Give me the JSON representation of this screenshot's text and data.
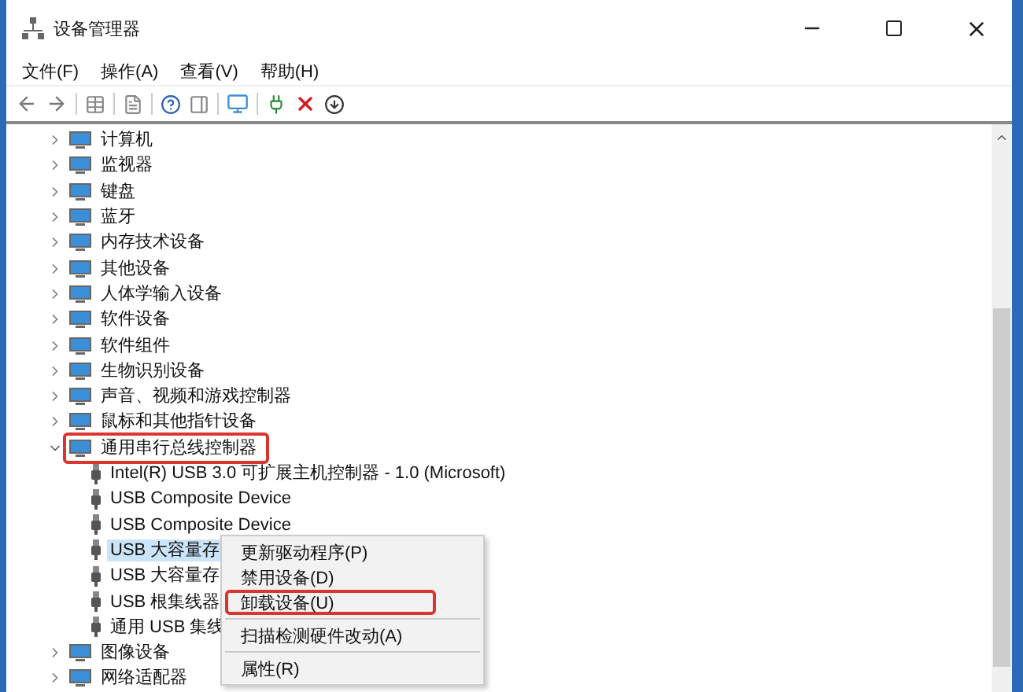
{
  "window": {
    "title": "设备管理器"
  },
  "menu_bar": [
    "文件(F)",
    "操作(A)",
    "查看(V)",
    "帮助(H)"
  ],
  "tree": [
    {
      "label": "计算机",
      "expanded": false,
      "selected": false,
      "highlighted": false
    },
    {
      "label": "监视器",
      "expanded": false,
      "selected": false,
      "highlighted": false
    },
    {
      "label": "键盘",
      "expanded": false,
      "selected": false,
      "highlighted": false
    },
    {
      "label": "蓝牙",
      "expanded": false,
      "selected": false,
      "highlighted": false
    },
    {
      "label": "内存技术设备",
      "expanded": false,
      "selected": false,
      "highlighted": false
    },
    {
      "label": "其他设备",
      "expanded": false,
      "selected": false,
      "highlighted": false
    },
    {
      "label": "人体学输入设备",
      "expanded": false,
      "selected": false,
      "highlighted": false
    },
    {
      "label": "软件设备",
      "expanded": false,
      "selected": false,
      "highlighted": false
    },
    {
      "label": "软件组件",
      "expanded": false,
      "selected": false,
      "highlighted": false
    },
    {
      "label": "生物识别设备",
      "expanded": false,
      "selected": false,
      "highlighted": false
    },
    {
      "label": "声音、视频和游戏控制器",
      "expanded": false,
      "selected": false,
      "highlighted": false
    },
    {
      "label": "鼠标和其他指针设备",
      "expanded": false,
      "selected": false,
      "highlighted": false
    },
    {
      "label": "通用串行总线控制器",
      "expanded": true,
      "selected": false,
      "highlighted": true,
      "children": [
        {
          "label": "Intel(R) USB 3.0 可扩展主机控制器 - 1.0 (Microsoft)",
          "selected": false,
          "highlighted": false
        },
        {
          "label": "USB Composite Device",
          "selected": false,
          "highlighted": false
        },
        {
          "label": "USB Composite Device",
          "selected": false,
          "highlighted": false
        },
        {
          "label": "USB 大容量存",
          "selected": true,
          "highlighted": false
        },
        {
          "label": "USB 大容量存",
          "selected": false,
          "highlighted": false
        },
        {
          "label": "USB 根集线器",
          "selected": false,
          "highlighted": false
        },
        {
          "label": "通用 USB 集线",
          "selected": false,
          "highlighted": false
        }
      ]
    },
    {
      "label": "图像设备",
      "expanded": false,
      "selected": false,
      "highlighted": false
    },
    {
      "label": "网络适配器",
      "expanded": false,
      "selected": false,
      "highlighted": false
    }
  ],
  "context_menu": {
    "groups": [
      [
        {
          "label": "更新驱动程序(P)",
          "highlighted": false
        },
        {
          "label": "禁用设备(D)",
          "highlighted": false
        },
        {
          "label": "卸载设备(U)",
          "highlighted": true
        }
      ],
      [
        {
          "label": "扫描检测硬件改动(A)",
          "highlighted": false
        }
      ],
      [
        {
          "label": "属性(R)",
          "highlighted": false
        }
      ]
    ]
  }
}
